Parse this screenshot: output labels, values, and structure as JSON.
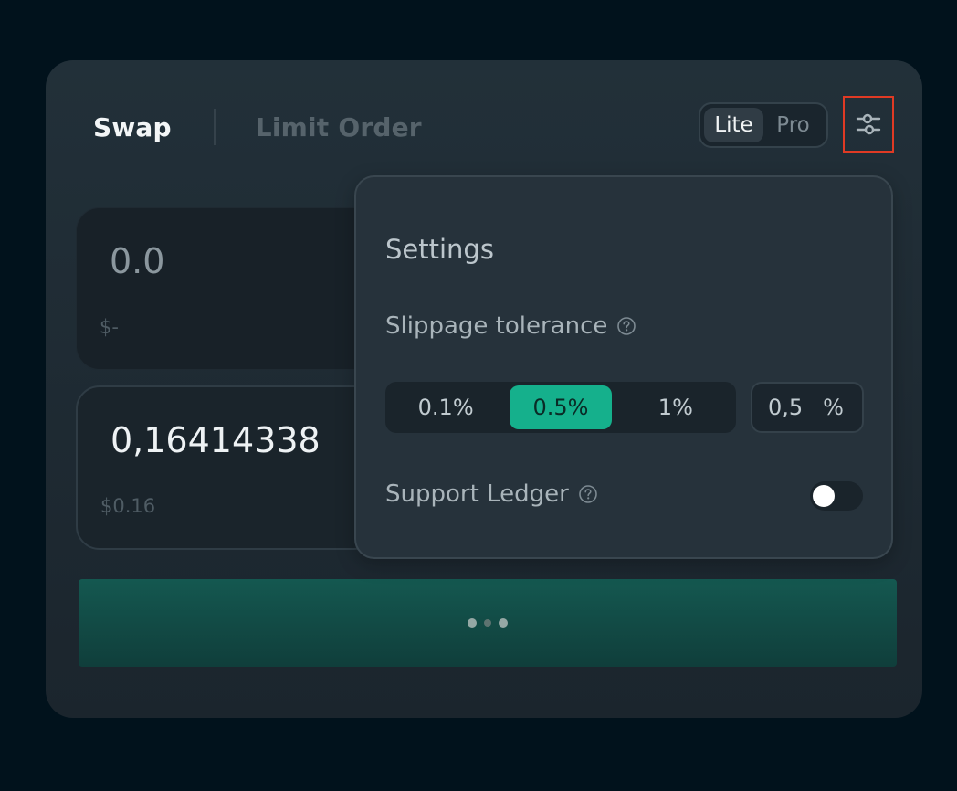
{
  "tabs": {
    "swap": "Swap",
    "limit_order": "Limit Order",
    "active": "swap"
  },
  "mode_toggle": {
    "options": [
      "Lite",
      "Pro"
    ],
    "selected": "Lite"
  },
  "settings_button": {
    "icon": "sliders-icon",
    "highlight_color": "#e03a24"
  },
  "from_input": {
    "amount": "0.0",
    "usd_value": "$-"
  },
  "to_input": {
    "amount": "0,16414338",
    "usd_value": "$0.16"
  },
  "swap_button": {
    "state": "loading",
    "icon": "loading-dots-icon"
  },
  "settings_panel": {
    "title": "Settings",
    "slippage_label": "Slippage tolerance",
    "slippage_options": [
      "0.1%",
      "0.5%",
      "1%"
    ],
    "slippage_selected": "0.5%",
    "custom_slippage_value": "0,5",
    "custom_slippage_unit": "%",
    "ledger_label": "Support Ledger",
    "ledger_enabled": false
  },
  "colors": {
    "accent": "#15b08c",
    "background": "#01121c",
    "card": "#1f2b33"
  }
}
